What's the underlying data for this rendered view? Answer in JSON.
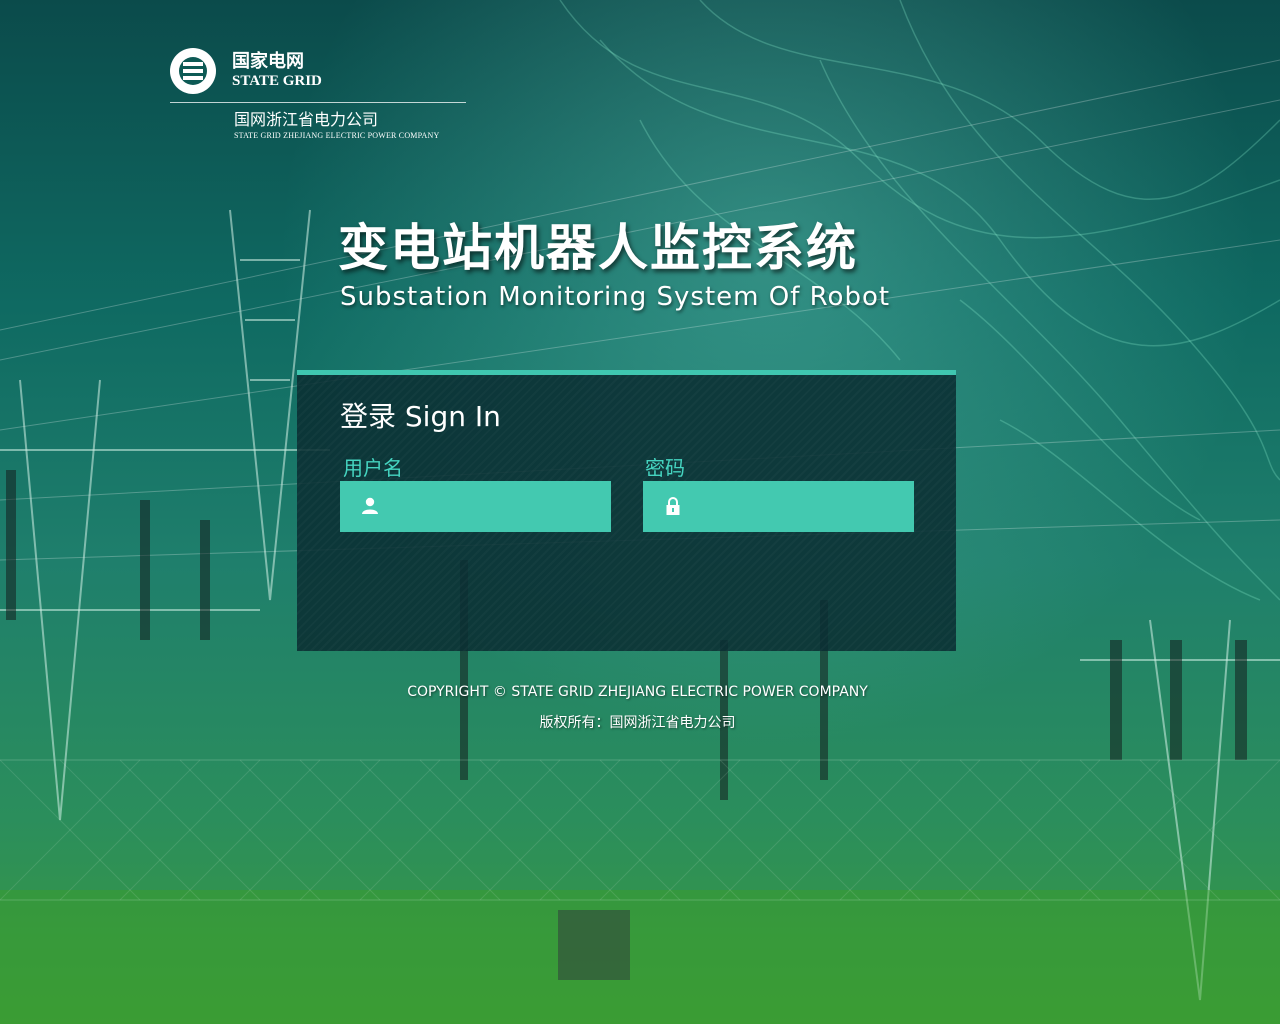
{
  "logo": {
    "emblem_icon": "state-grid-emblem-icon",
    "cn": "国家电网",
    "en": "STATE GRID",
    "sub_cn": "国网浙江省电力公司",
    "sub_en": "STATE GRID ZHEJIANG ELECTRIC POWER COMPANY"
  },
  "title": {
    "cn": "变电站机器人监控系统",
    "en": "Substation Monitoring System Of Robot"
  },
  "login": {
    "heading": "登录  Sign In",
    "username_label": "用户名",
    "username_value": "",
    "username_icon": "user-icon",
    "password_label": "密码",
    "password_value": "",
    "password_icon": "lock-icon"
  },
  "footer": {
    "copyright_en": "COPYRIGHT © STATE GRID ZHEJIANG ELECTRIC POWER COMPANY",
    "copyright_cn": "版权所有：国网浙江省电力公司"
  },
  "colors": {
    "accent": "#3fc7b0",
    "field_bg": "#43c9b0",
    "label": "#45d4c0",
    "panel_bg": "#0a2d32"
  }
}
